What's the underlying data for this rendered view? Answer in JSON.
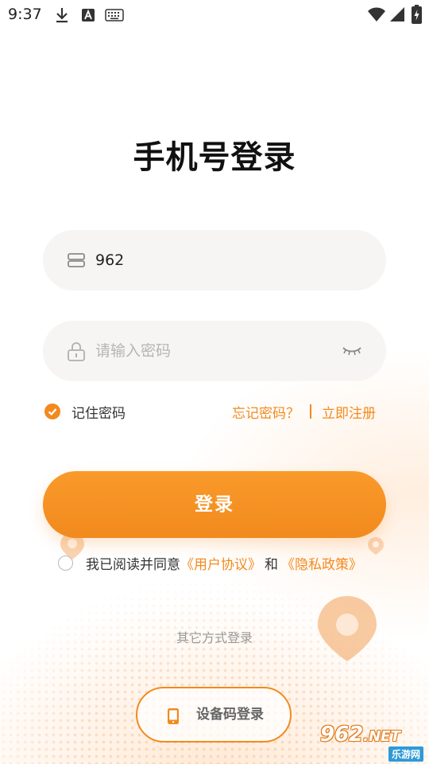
{
  "status_bar": {
    "time": "9:37",
    "left_icons": [
      "download-icon",
      "font-a-icon",
      "keyboard-icon"
    ],
    "right_icons": [
      "wifi-icon",
      "signal-icon",
      "battery-charging-icon"
    ]
  },
  "page_title": "手机号登录",
  "phone_field": {
    "value": "962",
    "icon": "account-card-icon"
  },
  "password_field": {
    "placeholder": "请输入密码",
    "icon": "lock-icon",
    "toggle_icon": "eye-closed-icon"
  },
  "remember": {
    "label": "记住密码",
    "checked": true
  },
  "links": {
    "forgot": "忘记密码？",
    "register": "立即注册"
  },
  "login_button": {
    "label": "登录"
  },
  "agreement": {
    "prefix": "我已阅读并同意",
    "user_agreement": "《用户协议》",
    "conjunction": "和",
    "privacy_policy": "《隐私政策》",
    "checked": false
  },
  "other_methods": {
    "label": "其它方式登录"
  },
  "device_login": {
    "label": "设备码登录",
    "icon": "phone-icon"
  },
  "watermark": {
    "top": "962",
    "net": ".NET",
    "bottom": "乐游网"
  },
  "colors": {
    "accent": "#f28a1e",
    "field_bg": "#f7f5f3",
    "text_dark": "#111111",
    "placeholder": "#b5b5b5"
  }
}
